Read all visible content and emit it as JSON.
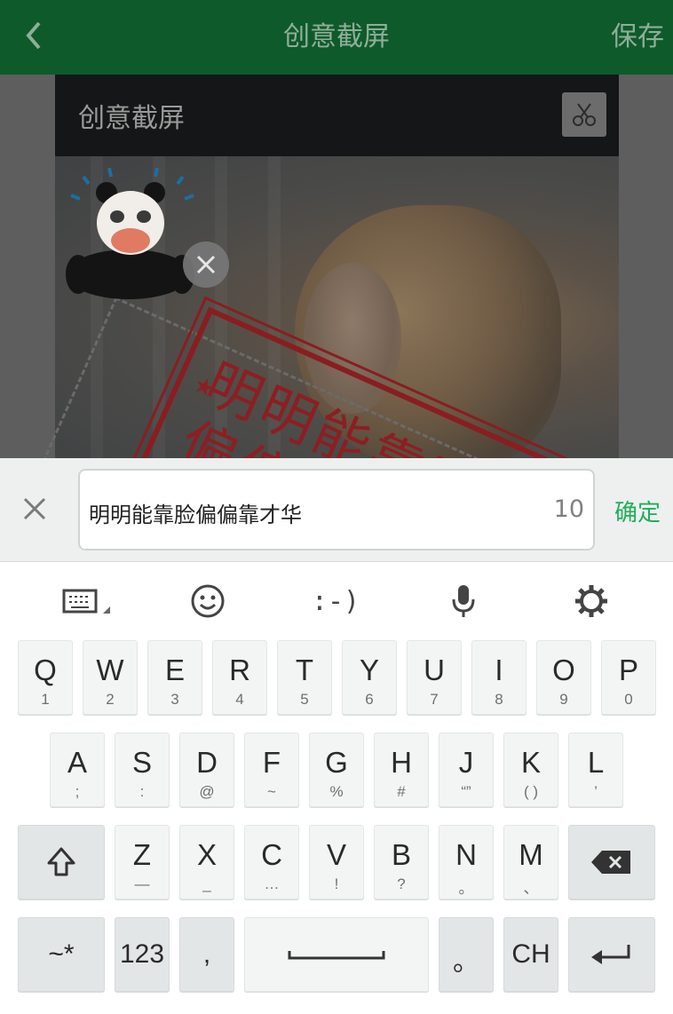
{
  "topbar": {
    "title": "创意截屏",
    "save_label": "保存"
  },
  "card": {
    "title": "创意截屏"
  },
  "stamp": {
    "text_line1": "明明能靠脸",
    "text_line2": "偏偏靠才华"
  },
  "input": {
    "value": "明明能靠脸偏偏靠才华",
    "count": "10",
    "confirm_label": "确定"
  },
  "toolbar": {
    "emoticon_text": ":-)"
  },
  "keyboard": {
    "row1": [
      {
        "main": "Q",
        "sub": "1"
      },
      {
        "main": "W",
        "sub": "2"
      },
      {
        "main": "E",
        "sub": "3"
      },
      {
        "main": "R",
        "sub": "4"
      },
      {
        "main": "T",
        "sub": "5"
      },
      {
        "main": "Y",
        "sub": "6"
      },
      {
        "main": "U",
        "sub": "7"
      },
      {
        "main": "I",
        "sub": "8"
      },
      {
        "main": "O",
        "sub": "9"
      },
      {
        "main": "P",
        "sub": "0"
      }
    ],
    "row2": [
      {
        "main": "A",
        "sub": ";"
      },
      {
        "main": "S",
        "sub": ":"
      },
      {
        "main": "D",
        "sub": "@"
      },
      {
        "main": "F",
        "sub": "~"
      },
      {
        "main": "G",
        "sub": "%"
      },
      {
        "main": "H",
        "sub": "#"
      },
      {
        "main": "J",
        "sub": "“”"
      },
      {
        "main": "K",
        "sub": "( )"
      },
      {
        "main": "L",
        "sub": "’"
      }
    ],
    "row3": [
      {
        "main": "Z",
        "sub": "—"
      },
      {
        "main": "X",
        "sub": "_"
      },
      {
        "main": "C",
        "sub": "…"
      },
      {
        "main": "V",
        "sub": "!"
      },
      {
        "main": "B",
        "sub": "?"
      },
      {
        "main": "N",
        "sub": "。"
      },
      {
        "main": "M",
        "sub": "、"
      }
    ],
    "symbols_label": "~*",
    "numbers_label": "123",
    "comma_label": ",",
    "period_label": "。",
    "lang_label": "CH"
  }
}
